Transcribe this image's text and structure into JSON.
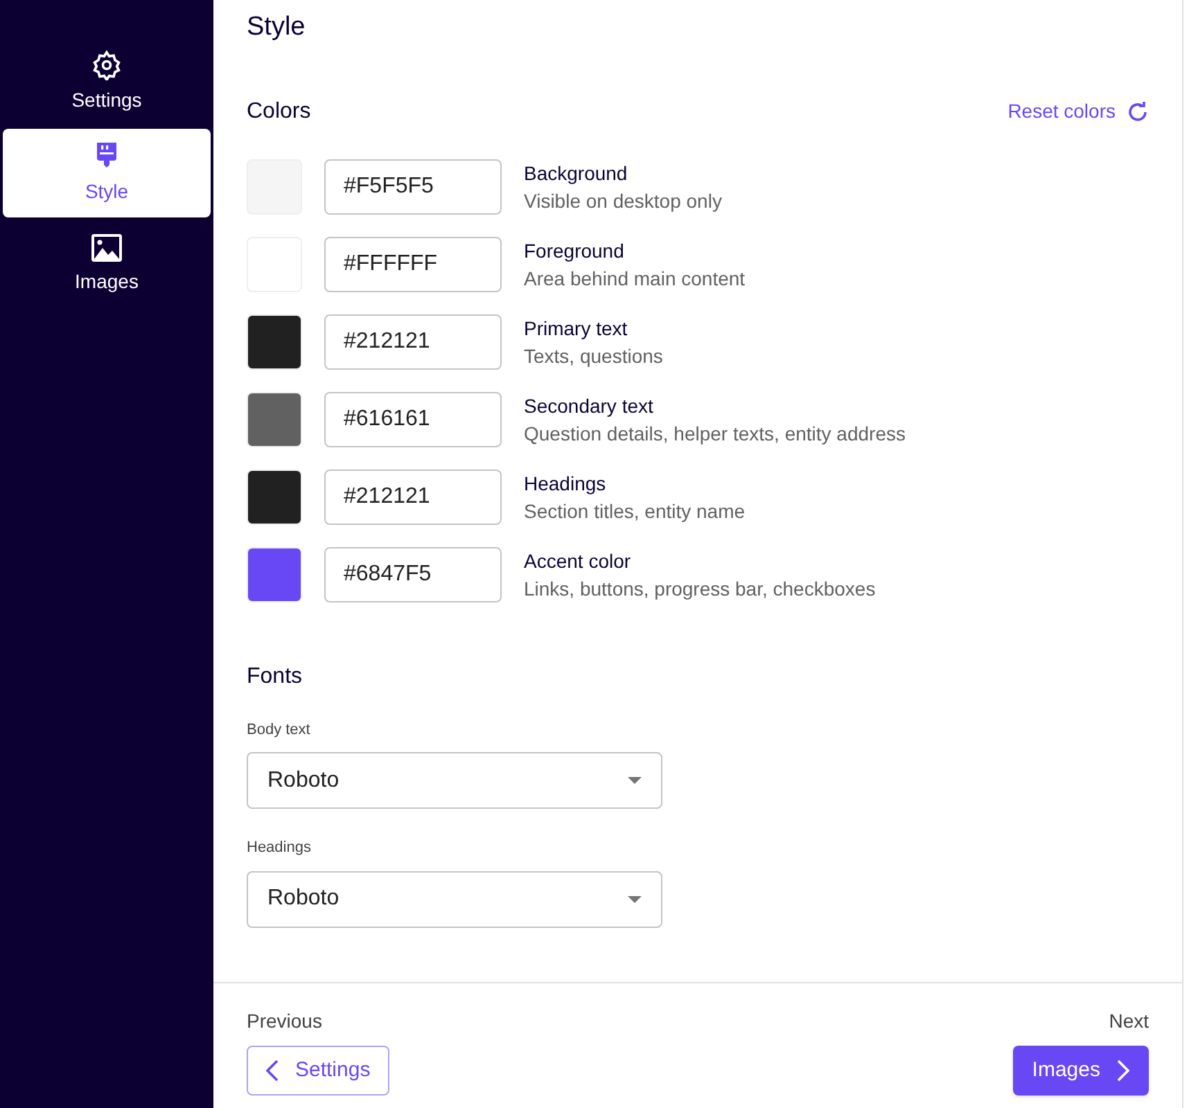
{
  "sidebar": {
    "items": [
      {
        "label": "Settings",
        "kind": "gear",
        "selected": false
      },
      {
        "label": "Style",
        "kind": "brush",
        "selected": true
      },
      {
        "label": "Images",
        "kind": "image",
        "selected": false
      }
    ]
  },
  "page_title": "Style",
  "colors": {
    "heading": "Colors",
    "reset": "Reset colors",
    "items": [
      {
        "value": "#F5F5F5",
        "color": "#f5f5f5",
        "label": "Background",
        "description": "Visible on desktop only"
      },
      {
        "value": "#FFFFFF",
        "color": "#ffffff",
        "label": "Foreground",
        "description": "Area behind main content"
      },
      {
        "value": "#212121",
        "color": "#212121",
        "label": "Primary text",
        "description": "Texts, questions"
      },
      {
        "value": "#616161",
        "color": "#616161",
        "label": "Secondary text",
        "description": "Question details, helper texts, entity address"
      },
      {
        "value": "#212121",
        "color": "#212121",
        "label": "Headings",
        "description": "Section titles, entity name"
      },
      {
        "value": "#6847F5",
        "color": "#6847f5",
        "label": "Accent color",
        "description": "Links, buttons, progress bar, checkboxes"
      }
    ]
  },
  "fonts": {
    "heading": "Fonts",
    "fields": [
      {
        "label": "Body text",
        "value": "Roboto"
      },
      {
        "label": "Headings",
        "value": "Roboto"
      }
    ]
  },
  "footer": {
    "previous_label": "Previous",
    "previous_button": "Settings",
    "next_label": "Next",
    "next_button": "Images"
  }
}
